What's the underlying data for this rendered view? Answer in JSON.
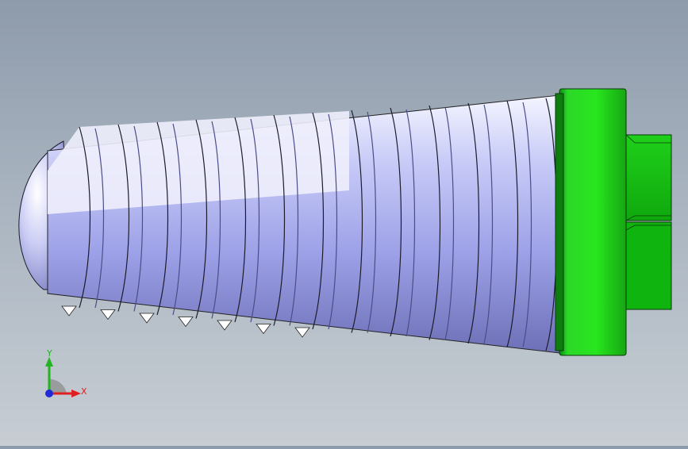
{
  "viewport": {
    "model": "screw",
    "background_colors": [
      "#8e9bab",
      "#c7cdd3"
    ],
    "thread_color": "#b9bff2",
    "head_color": "#22c41e"
  },
  "triad": {
    "x_label": "X",
    "y_label": "Y",
    "x_color": "#e02020",
    "y_color": "#22b422",
    "z_color": "#1f2ad8"
  }
}
